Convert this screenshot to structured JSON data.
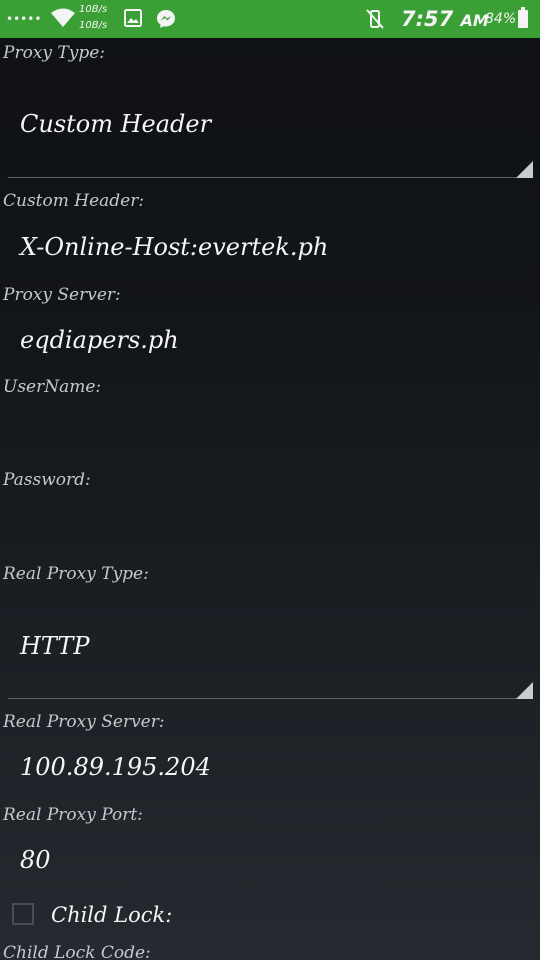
{
  "status_bar": {
    "signal_dots": "•••••",
    "wifi_icon": "wifi-icon",
    "speed_up": "10B/s",
    "speed_down": "10B/s",
    "gallery_icon": "gallery-icon",
    "messenger_icon": "messenger-icon",
    "mute_icon": "vibrate-off-icon",
    "time": "7:57",
    "ampm": "AM",
    "battery_percent": "84%",
    "battery_icon": "battery-icon",
    "bar_color": "#3aa035"
  },
  "form": {
    "proxy_type": {
      "label": "Proxy Type:",
      "value": "Custom Header"
    },
    "custom_header": {
      "label": "Custom Header:",
      "value": "X-Online-Host:evertek.ph"
    },
    "proxy_server": {
      "label": "Proxy Server:",
      "value": "eqdiapers.ph"
    },
    "username": {
      "label": "UserName:",
      "value": ""
    },
    "password": {
      "label": "Password:",
      "value": ""
    },
    "real_proxy_type": {
      "label": "Real Proxy Type:",
      "value": "HTTP"
    },
    "real_proxy_server": {
      "label": "Real Proxy Server:",
      "value": "100.89.195.204"
    },
    "real_proxy_port": {
      "label": "Real Proxy Port:",
      "value": "80"
    },
    "child_lock": {
      "label": "Child Lock:",
      "checked": false
    },
    "child_lock_code": {
      "label": "Child Lock Code:"
    }
  }
}
